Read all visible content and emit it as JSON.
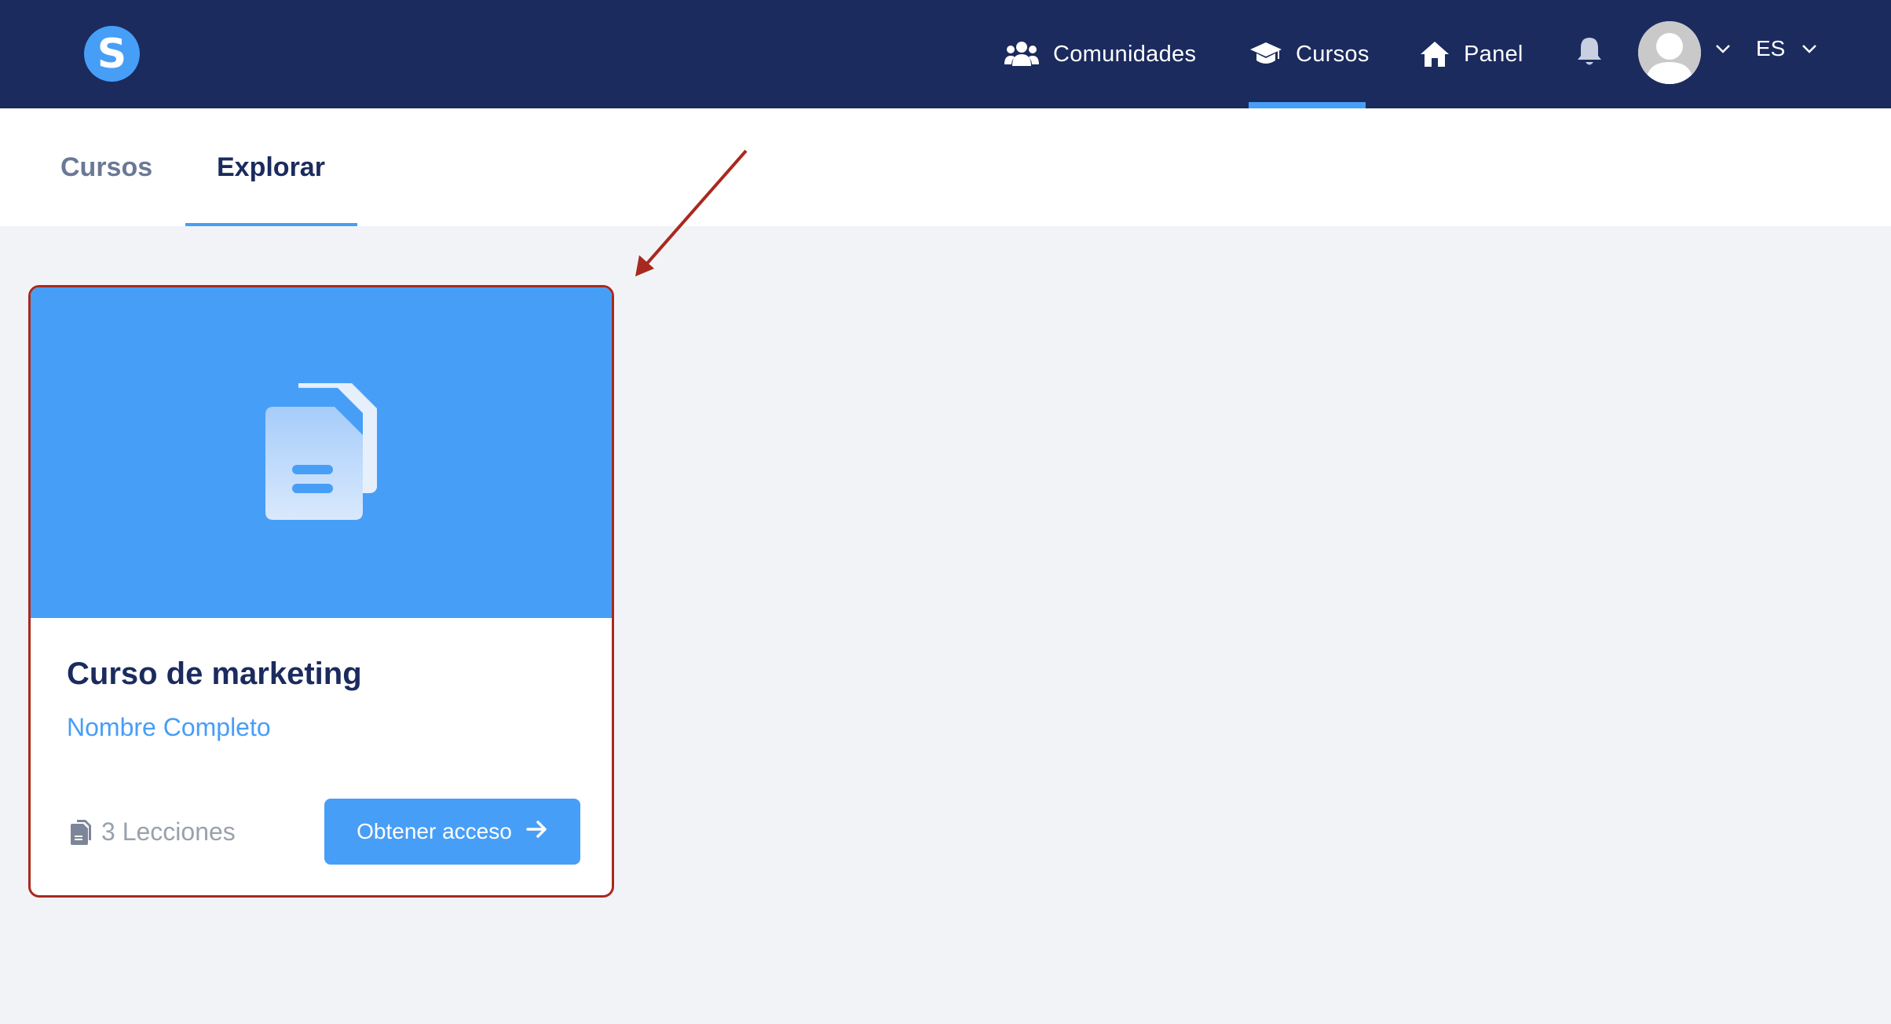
{
  "brand": {
    "logo_letter": "S",
    "logo_icon": "brand-logo",
    "accent": "#479ef7",
    "navbar_bg": "#1b2b5e"
  },
  "nav": {
    "items": [
      {
        "label": "Comunidades",
        "icon": "users-icon"
      },
      {
        "label": "Cursos",
        "icon": "graduation-cap-icon",
        "active": true
      },
      {
        "label": "Panel",
        "icon": "home-icon"
      }
    ],
    "notifications_icon": "bell-icon",
    "avatar_icon": "user-avatar",
    "language": "ES"
  },
  "tabs": [
    {
      "label": "Cursos"
    },
    {
      "label": "Explorar",
      "active": true
    }
  ],
  "annotation": {
    "arrow_color": "#a8291e",
    "highlight_color": "#a8291e"
  },
  "course_card": {
    "image_icon": "documents-icon",
    "title": "Curso de marketing",
    "author": "Nombre Completo",
    "lessons": "3 Lecciones",
    "lessons_icon": "documents-icon",
    "cta_label": "Obtener acceso",
    "cta_icon": "arrow-right-icon"
  }
}
